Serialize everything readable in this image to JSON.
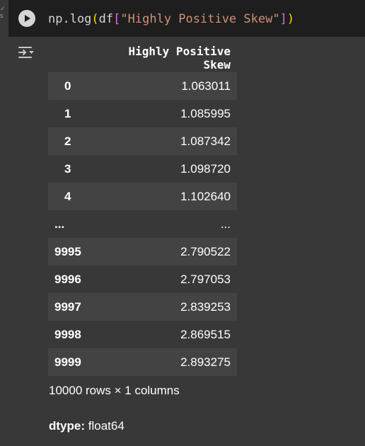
{
  "gutter": {
    "check": "✓",
    "time": "s"
  },
  "cell": {
    "code": {
      "fn": "np.log",
      "open_paren": "(",
      "obj": "df",
      "open_bracket": "[",
      "key": "\"Highly Positive Skew\"",
      "close_bracket": "]",
      "close_paren": ")"
    }
  },
  "output": {
    "column_header": "Highly Positive Skew",
    "rows": [
      {
        "index": "0",
        "value": "1.063011"
      },
      {
        "index": "1",
        "value": "1.085995"
      },
      {
        "index": "2",
        "value": "1.087342"
      },
      {
        "index": "3",
        "value": "1.098720"
      },
      {
        "index": "4",
        "value": "1.102640"
      },
      {
        "index": "...",
        "value": "..."
      },
      {
        "index": "9995",
        "value": "2.790522"
      },
      {
        "index": "9996",
        "value": "2.797053"
      },
      {
        "index": "9997",
        "value": "2.839253"
      },
      {
        "index": "9998",
        "value": "2.869515"
      },
      {
        "index": "9999",
        "value": "2.893275"
      }
    ],
    "shape": "10000 rows × 1 columns",
    "dtype_label": "dtype:",
    "dtype_value": "float64"
  }
}
